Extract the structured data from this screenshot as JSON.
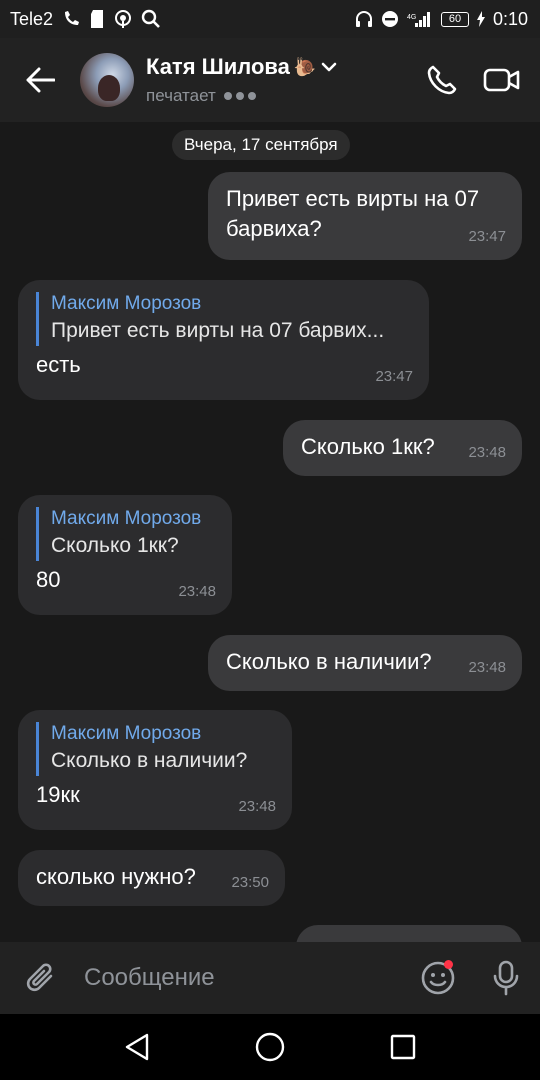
{
  "status_bar": {
    "carrier": "Tele2",
    "battery": "60",
    "time": "0:10"
  },
  "header": {
    "contact_name": "Катя Шилова",
    "name_emoji": "🐌",
    "typing_status": "печатает"
  },
  "chat": {
    "date_separator": "Вчера, 17 сентября",
    "messages": [
      {
        "direction": "out",
        "text": "Привет есть вирты на 07 барвиха?",
        "time": "23:47"
      },
      {
        "direction": "in",
        "reply_author": "Максим Морозов",
        "reply_text": "Привет есть вирты на 07 барвих...",
        "text": "есть",
        "time": "23:47"
      },
      {
        "direction": "out",
        "text": "Сколько 1кк?",
        "time": "23:48"
      },
      {
        "direction": "in",
        "reply_author": "Максим Морозов",
        "reply_text": "Сколько 1кк?",
        "text": "80",
        "time": "23:48"
      },
      {
        "direction": "out",
        "text": "Сколько в наличии?",
        "time": "23:48"
      },
      {
        "direction": "in",
        "reply_author": "Максим Морозов",
        "reply_text": "Сколько в наличии?",
        "text": "19кк",
        "time": "23:48"
      },
      {
        "direction": "in",
        "text": "сколько нужно?",
        "time": "23:50"
      }
    ]
  },
  "input": {
    "placeholder": "Сообщение"
  },
  "colors": {
    "background": "#191919",
    "bubble_out": "#3a3a3c",
    "bubble_in": "#2c2c2e",
    "accent": "#71aaeb",
    "badge": "#ff3347"
  },
  "icons": [
    "back-arrow-icon",
    "phone-icon",
    "video-camera-icon",
    "chevron-down-icon",
    "paperclip-icon",
    "emoji-icon",
    "microphone-icon",
    "nav-back-icon",
    "nav-home-icon",
    "nav-recents-icon"
  ]
}
